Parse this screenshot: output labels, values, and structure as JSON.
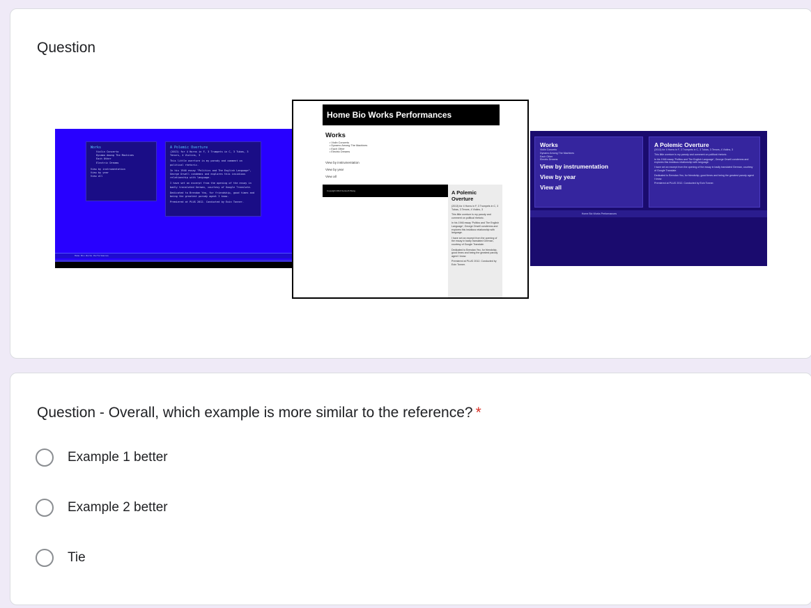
{
  "question1": {
    "title": "Question"
  },
  "examples": {
    "left": {
      "works_title": "Works",
      "works_items": [
        "Violin Concerto",
        "Dynamo Among The Machines",
        "Each Other",
        "Electric Dreams"
      ],
      "links": [
        "View by instrumentation",
        "View by year",
        "View all"
      ],
      "overture_title": "A Polemic Overture",
      "overture_lines": [
        "(2013) for 4 Horns in F, 3 Trumpets in C, 3 Tubas, 3 Tenors, 4 Violins, 3",
        "This little overture is my parody and comment on political rhetoric.",
        "In his 1946 essay \"Politics and The English Language\", George Orwell condemns and explores this insidious relationship with language.",
        "I have set an excerpt from the opening of the essay in badly translated German, courtesy of Google Translate.",
        "Dedicated to Brendan Yeo, for friendship, good times and being the greatest parody agent I know.",
        "Premiered at PLUG 2012. Conducted by Eoin Tonner."
      ],
      "footer": "Home Bio Works Performances"
    },
    "middle": {
      "nav": "Home Bio Works Performances",
      "works_title": "Works",
      "works_items": [
        "Violin Concerto",
        "Dynamo Among The Machines",
        "Each Other",
        "Electric Dreams"
      ],
      "links": [
        "View by instrumentation",
        "View by year",
        "View all"
      ],
      "copyright": "Copyright 2014 Kenneth Wong",
      "overture_title": "A Polemic Overture",
      "overture_lines": [
        "(2013) for 4 Horns in F, 3 Trumpets in C, 3 Tubas, 3 Tenors, 4 Violins, 3",
        "This little overture is my parody and comment on political rhetoric.",
        "In his 1946 essay 'Politics and The English Language', George Orwell condemns and explores this insidious relationship with language.",
        "I have set an excerpt from the opening of the essay in badly translated German, courtesy of Google Translate.",
        "Dedicated to Brendan Yeo, for friendship, good times and being the greatest parody agent I know.",
        "Premiered at PLUG 2012. Conducted by Eoin Tonner."
      ]
    },
    "right": {
      "works_title": "Works",
      "works_items": [
        "Violin Concerto",
        "Dynamo Among The Machines",
        "Each Other",
        "Electric Dreams"
      ],
      "links": [
        "View by instrumentation",
        "View by year",
        "View all"
      ],
      "overture_title": "A Polemic Overture",
      "overture_lines": [
        "(2013) for 4 Horns in F, 3 Trumpets in C, 3 Tubas, 3 Tenors, 4 Violins, 3",
        "This little overture is my parody and comment on political rhetoric.",
        "In his 1946 essay 'Politics and The English Language', George Orwell condemns and explores this insidious relationship with language.",
        "I have set an excerpt from the opening of the essay in badly translated German, courtesy of Google Translate.",
        "Dedicated to Brendan Yeo, for friendship, good times and being the greatest parody agent I know.",
        "Premiered at PLUG 2012. Conducted by Eoin Tonner."
      ],
      "footer": "Home Bio Works Performances"
    }
  },
  "question2": {
    "title": "Question - Overall, which example is more similar to the reference?",
    "required_mark": "*",
    "options": [
      "Example 1 better",
      "Example 2 better",
      "Tie"
    ]
  },
  "colors": {
    "page_bg": "#efeaf7",
    "required": "#d93025",
    "left_bg": "#2800ff",
    "right_bg": "#1a0b6e"
  }
}
